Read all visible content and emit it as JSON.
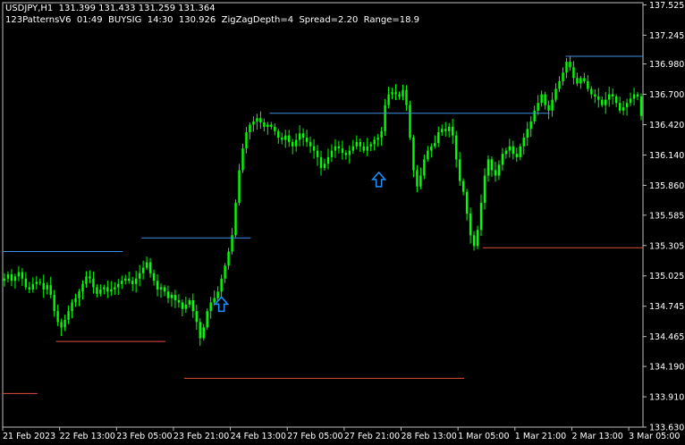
{
  "header": {
    "symbol_line": "USDJPY,H1  131.399 131.433 131.259 131.364",
    "indicator_line": "123PatternsV6  01:49  BUYSIG  14:30  130.926  ZigZagDepth=4  Spread=2.20  Range=18.9"
  },
  "colors": {
    "background": "#000000",
    "candle": "#00ff00",
    "frame": "#c0c0c0",
    "blue_level": "#3d8fe0",
    "red_level": "#e0503c",
    "arrow": "#1e90ff",
    "text": "#ffffff"
  },
  "icons": [
    "up-arrow-icon",
    "up-arrow-icon"
  ],
  "chart_data": {
    "type": "candlestick",
    "symbol": "USDJPY",
    "timeframe": "H1",
    "ylim": [
      133.63,
      137.545
    ],
    "y_ticks": [
      137.525,
      137.245,
      136.98,
      136.7,
      136.42,
      136.14,
      135.86,
      135.585,
      135.305,
      135.025,
      134.745,
      134.465,
      134.19,
      133.91,
      133.63
    ],
    "y_tick_labels": [
      "137.525",
      "137.245",
      "136.980",
      "136.700",
      "136.420",
      "136.140",
      "135.860",
      "135.585",
      "135.305",
      "135.025",
      "134.745",
      "134.465",
      "134.190",
      "133.910",
      "133.630"
    ],
    "x_tick_labels": [
      "21 Feb 2023",
      "22 Feb 13:00",
      "23 Feb 05:00",
      "23 Feb 21:00",
      "24 Feb 13:00",
      "27 Feb 05:00",
      "27 Feb 21:00",
      "28 Feb 13:00",
      "1 Mar 05:00",
      "1 Mar 21:00",
      "2 Mar 13:00",
      "3 Mar 05:00"
    ],
    "x_tick_index": [
      0,
      16,
      32,
      48,
      64,
      80,
      96,
      112,
      128,
      144,
      160,
      176
    ],
    "bar_count": 180,
    "closes": [
      135.0,
      135.04,
      134.98,
      135.02,
      135.06,
      135.0,
      134.92,
      134.9,
      134.95,
      134.97,
      134.96,
      134.9,
      134.94,
      134.85,
      134.7,
      134.6,
      134.55,
      134.62,
      134.7,
      134.78,
      134.82,
      134.88,
      134.95,
      135.02,
      135.0,
      134.92,
      134.86,
      134.9,
      134.92,
      134.88,
      134.9,
      134.92,
      134.95,
      134.98,
      135.0,
      134.98,
      134.95,
      135.0,
      135.05,
      135.1,
      135.15,
      135.05,
      134.98,
      134.9,
      134.92,
      134.88,
      134.82,
      134.85,
      134.8,
      134.78,
      134.72,
      134.76,
      134.8,
      134.7,
      134.6,
      134.45,
      134.55,
      134.7,
      134.78,
      134.82,
      134.88,
      135.0,
      135.12,
      135.25,
      135.4,
      135.7,
      136.0,
      136.2,
      136.35,
      136.42,
      136.45,
      136.48,
      136.44,
      136.4,
      136.42,
      136.4,
      136.36,
      136.3,
      136.28,
      136.32,
      136.26,
      136.22,
      136.28,
      136.34,
      136.3,
      136.26,
      136.22,
      136.18,
      136.12,
      136.02,
      136.06,
      136.12,
      136.18,
      136.22,
      136.2,
      136.16,
      136.14,
      136.18,
      136.22,
      136.26,
      136.22,
      136.18,
      136.22,
      136.24,
      136.28,
      136.3,
      136.36,
      136.6,
      136.7,
      136.72,
      136.7,
      136.68,
      136.74,
      136.6,
      136.3,
      136.0,
      135.85,
      135.95,
      136.1,
      136.18,
      136.22,
      136.25,
      136.35,
      136.38,
      136.36,
      136.4,
      136.32,
      136.1,
      135.9,
      135.8,
      135.6,
      135.4,
      135.3,
      135.45,
      135.7,
      135.95,
      136.1,
      136.0,
      135.95,
      136.05,
      136.15,
      136.18,
      136.22,
      136.15,
      136.12,
      136.22,
      136.3,
      136.38,
      136.45,
      136.55,
      136.62,
      136.7,
      136.6,
      136.55,
      136.65,
      136.75,
      136.82,
      136.9,
      137.0,
      136.95,
      136.85,
      136.8,
      136.85,
      136.82,
      136.75,
      136.7,
      136.68,
      136.65,
      136.6,
      136.65,
      136.7,
      136.68,
      136.62,
      136.55,
      136.58,
      136.62,
      136.66,
      136.7,
      136.68,
      136.5
    ],
    "levels": [
      {
        "kind": "resistance",
        "color": "blue",
        "price": 135.25,
        "from": 0,
        "to": 45
      },
      {
        "kind": "resistance",
        "color": "blue",
        "price": 135.375,
        "from": 52,
        "to": 93
      },
      {
        "kind": "resistance",
        "color": "blue",
        "price": 136.525,
        "from": 100,
        "to": 205
      },
      {
        "kind": "resistance",
        "color": "blue",
        "price": 137.05,
        "from": 211,
        "to": 240
      },
      {
        "kind": "support",
        "color": "red",
        "price": 134.42,
        "from": 20,
        "to": 61
      },
      {
        "kind": "support",
        "color": "red",
        "price": 134.08,
        "from": 68,
        "to": 173
      },
      {
        "kind": "support",
        "color": "red",
        "price": 135.285,
        "from": 180,
        "to": 240
      },
      {
        "kind": "support",
        "color": "red",
        "price": 133.94,
        "from": 0,
        "to": 13
      }
    ],
    "buy_signals": [
      {
        "bar": 82,
        "price": 134.83
      },
      {
        "bar": 141,
        "price": 135.98
      }
    ]
  }
}
